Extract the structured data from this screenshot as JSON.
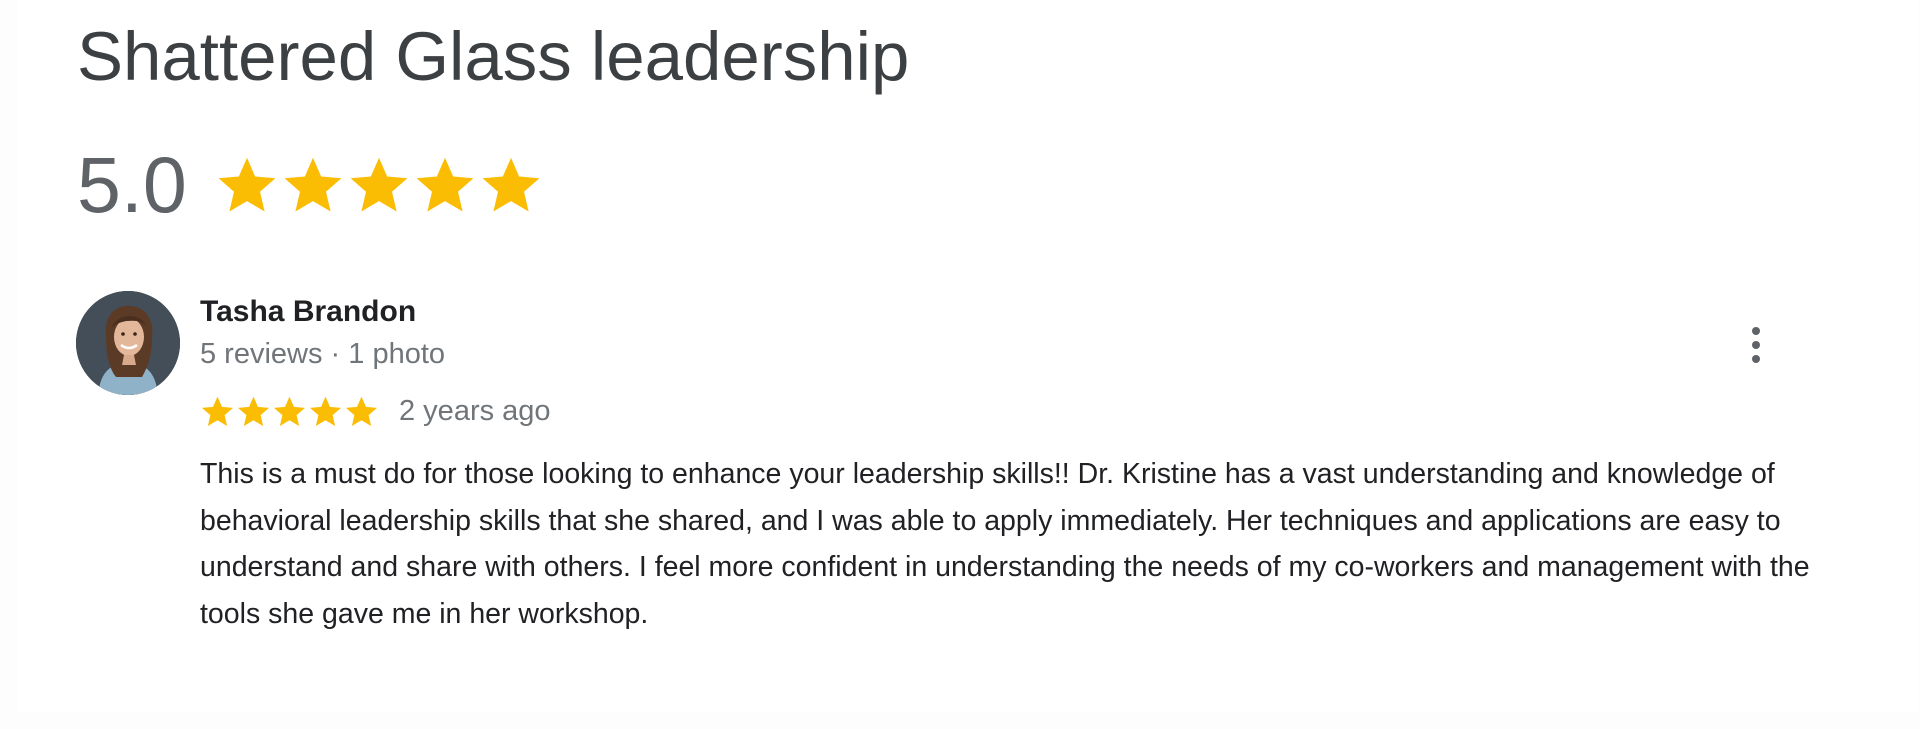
{
  "place": {
    "title": "Shattered Glass leadership",
    "rating": "5.0",
    "stars": 5,
    "star_color": "#fbbc04"
  },
  "review": {
    "reviewer_name": "Tasha Brandon",
    "reviewer_meta": "5 reviews · 1 photo",
    "stars": 5,
    "time": "2 years ago",
    "text": "This is a must do for those looking to enhance your leadership skills!! Dr. Kristine has a vast understanding and knowledge of behavioral leadership skills that she shared, and I was able to apply immediately. Her techniques and applications are easy to understand and share with others. I feel more confident in understanding the needs of my co-workers and management with the tools she gave me in her workshop.",
    "more_icon": "more-vert-icon",
    "avatar_icon": "avatar-photo"
  }
}
